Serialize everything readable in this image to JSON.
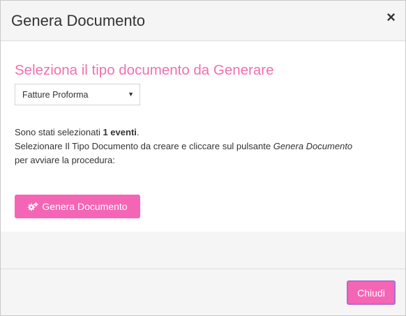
{
  "modal": {
    "title": "Genera Documento",
    "close_icon": "×"
  },
  "body": {
    "section_title": "Seleziona il tipo documento da Generare",
    "select": {
      "value": "Fatture Proforma",
      "caret": "▼"
    },
    "info": {
      "line1_prefix": "Sono stati selezionati ",
      "line1_bold": "1 eventi",
      "line1_suffix": ".",
      "line2_prefix": "Selezionare Il Tipo Documento da creare e cliccare sul pulsante ",
      "line2_italic": "Genera Documento",
      "line3": "per avviare la procedura:"
    },
    "generate_button": {
      "icon": "cogs-icon",
      "label": "Genera Documento"
    }
  },
  "footer": {
    "close_button_label": "Chiudi"
  },
  "colors": {
    "accent": "#f565b5",
    "title_pink": "#f26fb0"
  }
}
